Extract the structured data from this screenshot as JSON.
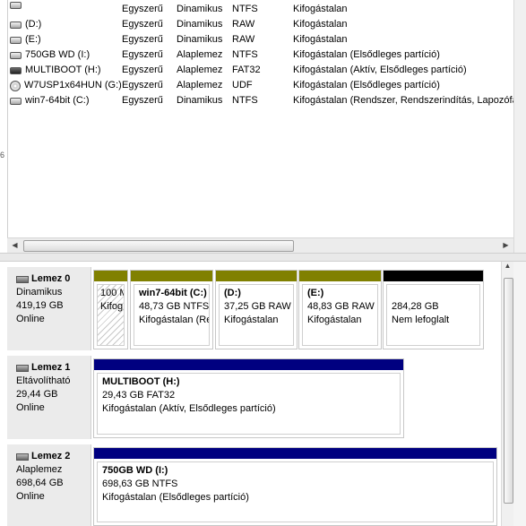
{
  "volumes": [
    {
      "name": "",
      "layout": "Egyszerű",
      "type": "Dinamikus",
      "fs": "NTFS",
      "status": "Kifogástalan",
      "icon": "drive-icon"
    },
    {
      "name": "(D:)",
      "layout": "Egyszerű",
      "type": "Dinamikus",
      "fs": "RAW",
      "status": "Kifogástalan",
      "icon": "drive-icon"
    },
    {
      "name": "(E:)",
      "layout": "Egyszerű",
      "type": "Dinamikus",
      "fs": "RAW",
      "status": "Kifogástalan",
      "icon": "drive-icon"
    },
    {
      "name": "750GB WD (I:)",
      "layout": "Egyszerű",
      "type": "Alaplemez",
      "fs": "NTFS",
      "status": "Kifogástalan (Elsődleges partíció)",
      "icon": "drive-icon"
    },
    {
      "name": "MULTIBOOT (H:)",
      "layout": "Egyszerű",
      "type": "Alaplemez",
      "fs": "FAT32",
      "status": "Kifogástalan (Aktív, Elsődleges partíció)",
      "icon": "removable-drive-icon"
    },
    {
      "name": "W7USP1x64HUN (G:)",
      "layout": "Egyszerű",
      "type": "Alaplemez",
      "fs": "UDF",
      "status": "Kifogástalan (Elsődleges partíció)",
      "icon": "cd-drive-icon"
    },
    {
      "name": "win7-64bit (C:)",
      "layout": "Egyszerű",
      "type": "Dinamikus",
      "fs": "NTFS",
      "status": "Kifogástalan (Rendszer, Rendszerindítás, Lapozófájl,",
      "icon": "drive-icon"
    }
  ],
  "left_mark": "6",
  "disks": [
    {
      "title": "Lemez 0",
      "type": "Dinamikus",
      "size": "419,19 GB",
      "state": "Online",
      "partitions": [
        {
          "line1": "100 M",
          "line2": "Kifog",
          "bar_color": "#808000",
          "hatched": true
        },
        {
          "title": "win7-64bit  (C:)",
          "line1": "48,73 GB NTFS",
          "line2": "Kifogástalan (Rer",
          "bar_color": "#808000"
        },
        {
          "title": "(D:)",
          "line1": "37,25 GB RAW",
          "line2": "Kifogástalan",
          "bar_color": "#808000"
        },
        {
          "title": "(E:)",
          "line1": "48,83 GB RAW",
          "line2": "Kifogástalan",
          "bar_color": "#808000"
        },
        {
          "line1": "284,28 GB",
          "line2": "Nem lefoglalt",
          "bar_color": "#000000"
        }
      ]
    },
    {
      "title": "Lemez 1",
      "type": "Eltávolítható",
      "size": "29,44 GB",
      "state": "Online",
      "partitions": [
        {
          "title": "MULTIBOOT  (H:)",
          "line1": "29,43 GB FAT32",
          "line2": "Kifogástalan (Aktív, Elsődleges partíció)",
          "bar_color": "#000080"
        }
      ]
    },
    {
      "title": "Lemez 2",
      "type": "Alaplemez",
      "size": "698,64 GB",
      "state": "Online",
      "partitions": [
        {
          "title": "750GB WD  (I:)",
          "line1": "698,63 GB NTFS",
          "line2": "Kifogástalan (Elsődleges partíció)",
          "bar_color": "#000080"
        }
      ]
    }
  ],
  "colors": {
    "primary_partition": "#000080",
    "dynamic_partition": "#808000",
    "unallocated": "#000000"
  }
}
